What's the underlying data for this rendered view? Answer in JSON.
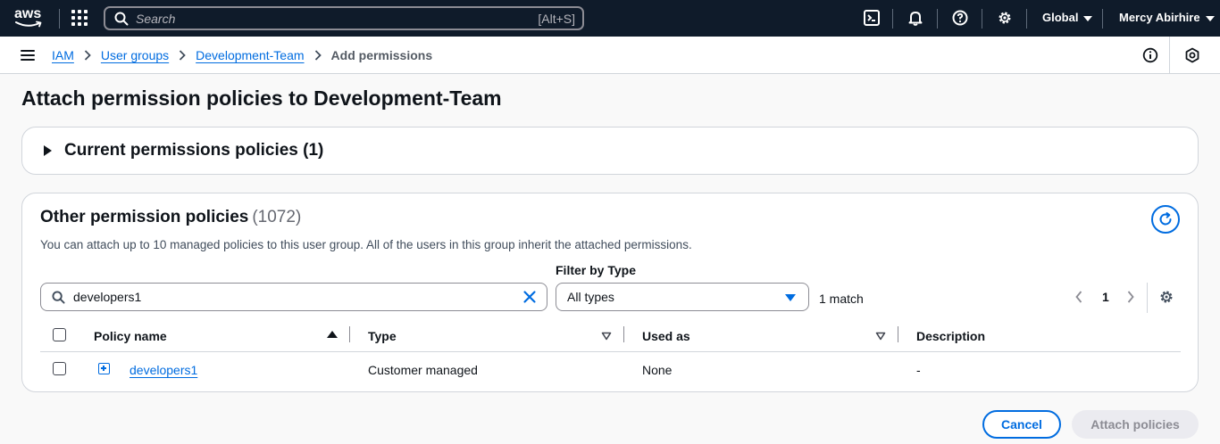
{
  "topnav": {
    "logo_text": "aws",
    "search_placeholder": "Search",
    "search_shortcut": "[Alt+S]",
    "region": "Global",
    "user": "Mercy Abirhire",
    "icons": [
      "services-grid-icon",
      "search-icon",
      "cloudshell-icon",
      "bell-icon",
      "help-icon",
      "gear-icon"
    ]
  },
  "breadcrumb": {
    "items": [
      "IAM",
      "User groups",
      "Development-Team"
    ],
    "current": "Add permissions"
  },
  "page": {
    "title": "Attach permission policies to Development-Team"
  },
  "current_policies": {
    "label": "Current permissions policies (1)"
  },
  "other_policies": {
    "title": "Other permission policies",
    "count": "(1072)",
    "description": "You can attach up to 10 managed policies to this user group. All of the users in this group inherit the attached permissions.",
    "filter_value": "developers1",
    "filter_type_label": "Filter by Type",
    "filter_type_value": "All types",
    "match_text": "1 match",
    "page_number": "1",
    "columns": [
      "Policy name",
      "Type",
      "Used as",
      "Description"
    ],
    "rows": [
      {
        "policy_name": "developers1",
        "type": "Customer managed",
        "used_as": "None",
        "description": "-"
      }
    ]
  },
  "footer": {
    "cancel_label": "Cancel",
    "attach_label": "Attach policies"
  },
  "colors": {
    "nav_bg": "#0f1b2a",
    "link": "#006ce0",
    "disabled_bg": "#ebebf0"
  }
}
